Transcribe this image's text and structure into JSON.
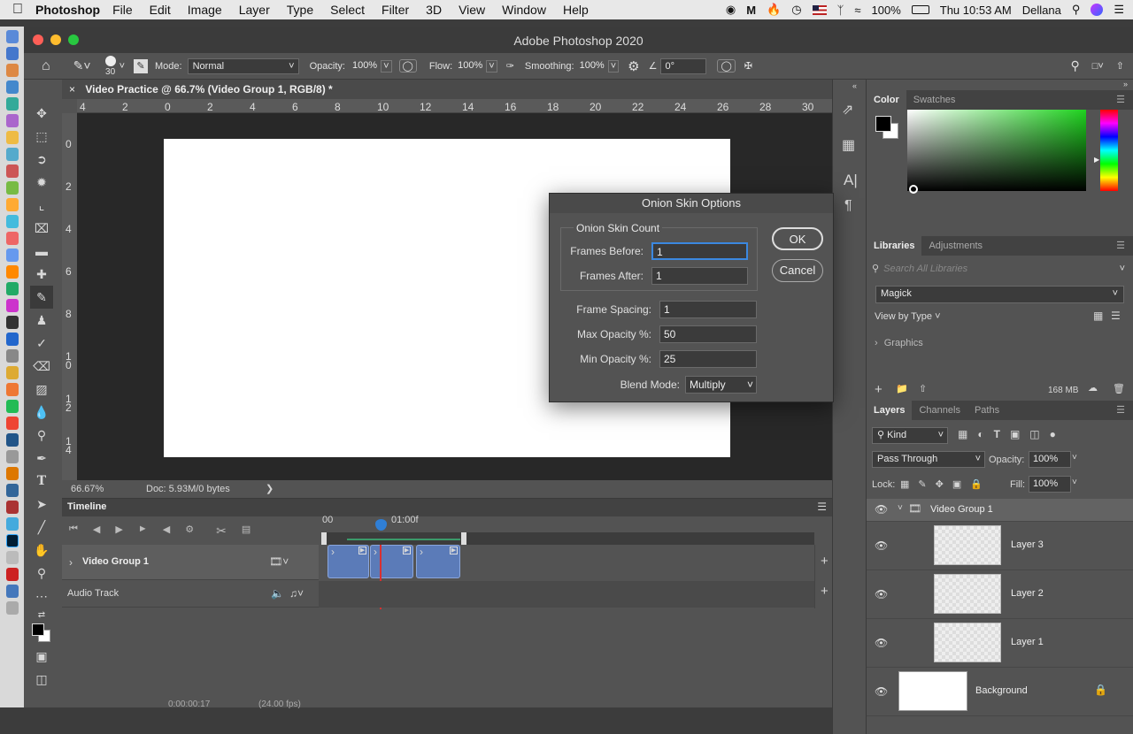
{
  "menubar": {
    "app": "Photoshop",
    "items": [
      "File",
      "Edit",
      "Image",
      "Layer",
      "Type",
      "Select",
      "Filter",
      "3D",
      "View",
      "Window",
      "Help"
    ],
    "battery": "100%",
    "clock": "Thu 10:53 AM",
    "user": "Dellana"
  },
  "window": {
    "title": "Adobe Photoshop 2020"
  },
  "options": {
    "brush_size": "30",
    "mode_label": "Mode:",
    "mode_value": "Normal",
    "opacity_label": "Opacity:",
    "opacity_value": "100%",
    "flow_label": "Flow:",
    "flow_value": "100%",
    "smoothing_label": "Smoothing:",
    "smoothing_value": "100%",
    "angle_value": "0°"
  },
  "document": {
    "tab_title": "Video Practice @ 66.7% (Video Group 1, RGB/8) *",
    "zoom": "66.67%",
    "doc_size": "Doc: 5.93M/0 bytes",
    "hruler": [
      "4",
      "2",
      "0",
      "2",
      "4",
      "6",
      "8",
      "10",
      "12",
      "14",
      "16",
      "18",
      "20",
      "22",
      "24",
      "26",
      "28",
      "30"
    ],
    "vruler": [
      "0",
      "2",
      "4",
      "6",
      "8",
      "1\n0",
      "1\n2",
      "1\n4"
    ]
  },
  "timeline": {
    "title": "Timeline",
    "time_start": "00",
    "time_mark": "01:00f",
    "track1": "Video Group 1",
    "track2": "Audio Track",
    "bottom_time": "0:00:00:17",
    "bottom_fps": "(24.00 fps)"
  },
  "dialog": {
    "title": "Onion Skin Options",
    "group_title": "Onion Skin Count",
    "frames_before_label": "Frames Before:",
    "frames_before": "1",
    "frames_after_label": "Frames After:",
    "frames_after": "1",
    "frame_spacing_label": "Frame Spacing:",
    "frame_spacing": "1",
    "max_opacity_label": "Max Opacity %:",
    "max_opacity": "50",
    "min_opacity_label": "Min Opacity %:",
    "min_opacity": "25",
    "blend_mode_label": "Blend Mode:",
    "blend_mode": "Multiply",
    "ok": "OK",
    "cancel": "Cancel"
  },
  "color_panel": {
    "tab1": "Color",
    "tab2": "Swatches"
  },
  "libraries": {
    "tab1": "Libraries",
    "tab2": "Adjustments",
    "search_placeholder": "Search All Libraries",
    "library": "Magick",
    "view_by": "View by Type",
    "group": "Graphics",
    "size": "168 MB"
  },
  "layers": {
    "tab1": "Layers",
    "tab2": "Channels",
    "tab3": "Paths",
    "filter": "Kind",
    "blend": "Pass Through",
    "opacity_label": "Opacity:",
    "opacity": "100%",
    "lock_label": "Lock:",
    "fill_label": "Fill:",
    "fill": "100%",
    "group": "Video Group 1",
    "items": [
      "Layer 3",
      "Layer 2",
      "Layer 1"
    ],
    "background": "Background"
  },
  "colors": {
    "clip": "#5b7bb8",
    "playhead": "#d83030",
    "accent": "#2f7fd6"
  }
}
